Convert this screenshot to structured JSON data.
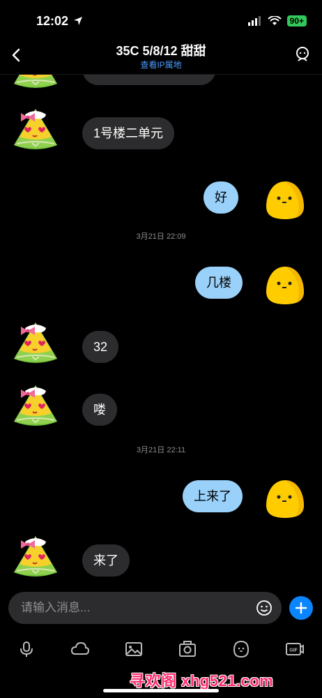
{
  "status_bar": {
    "time": "12:02",
    "battery": "90+"
  },
  "header": {
    "title": "35C 5/8/12 甜甜",
    "subtitle": "查看IP属地"
  },
  "messages": [
    {
      "side": "in",
      "text": "1号楼二单元"
    },
    {
      "side": "out",
      "text": "好"
    },
    {
      "side": "time",
      "text": "3月21日 22:09"
    },
    {
      "side": "out",
      "text": "几楼"
    },
    {
      "side": "in",
      "text": "32"
    },
    {
      "side": "in",
      "text": "喽"
    },
    {
      "side": "time",
      "text": "3月21日 22:11"
    },
    {
      "side": "out",
      "text": "上来了"
    },
    {
      "side": "in",
      "text": "来了"
    }
  ],
  "input": {
    "placeholder": "请输入消息..."
  },
  "toolbar": {
    "icons": [
      "microphone-icon",
      "cloud-icon",
      "image-icon",
      "camera-icon",
      "sticker-icon",
      "gif-icon"
    ]
  },
  "watermark": "寻欢阁 xhg521.com",
  "colors": {
    "incoming_bubble": "#2c2c2e",
    "outgoing_bubble": "#9ad1fa",
    "accent": "#0a84ff",
    "link": "#4a9eff"
  }
}
